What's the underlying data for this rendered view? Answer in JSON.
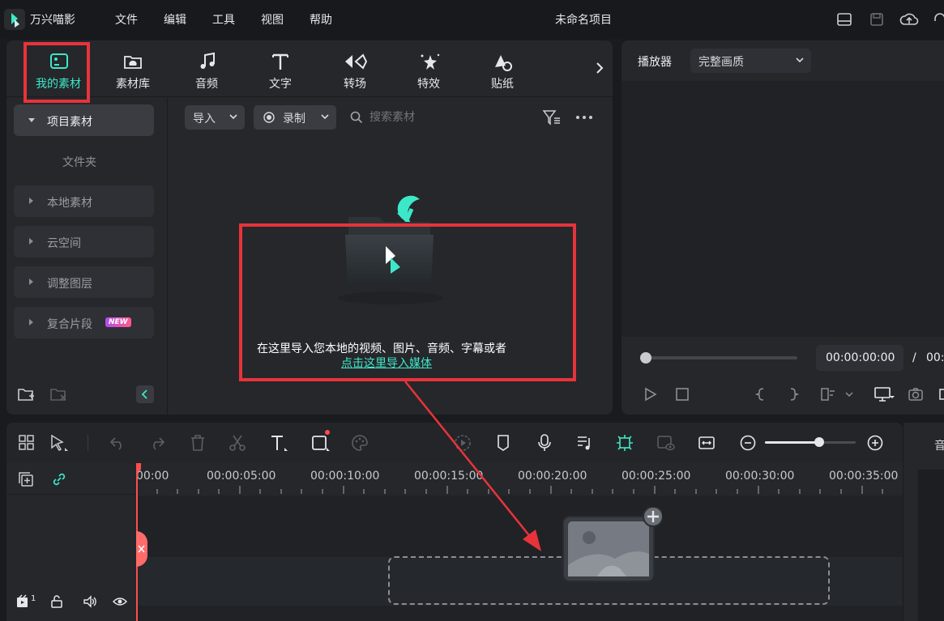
{
  "app": {
    "name": "万兴喵影",
    "project_title": "未命名项目"
  },
  "menu": [
    "文件",
    "编辑",
    "工具",
    "视图",
    "帮助"
  ],
  "tabs": [
    {
      "label": "我的素材",
      "icon": "my-media-icon",
      "active": true
    },
    {
      "label": "素材库",
      "icon": "stock-library-icon"
    },
    {
      "label": "音频",
      "icon": "music-note-icon"
    },
    {
      "label": "文字",
      "icon": "text-icon"
    },
    {
      "label": "转场",
      "icon": "transition-icon"
    },
    {
      "label": "特效",
      "icon": "effects-icon"
    },
    {
      "label": "贴纸",
      "icon": "sticker-icon"
    }
  ],
  "sidebar": {
    "project_media": "项目素材",
    "folder": "文件夹",
    "items": [
      "本地素材",
      "云空间",
      "调整图层",
      "复合片段"
    ],
    "new_badge": "NEW"
  },
  "media_toolbar": {
    "import": "导入",
    "record": "录制",
    "search_placeholder": "搜索素材"
  },
  "media_empty": {
    "hint": "在这里导入您本地的视频、图片、音频、字幕或者",
    "link": "点击这里导入媒体"
  },
  "player": {
    "label": "播放器",
    "quality": "完整画质",
    "timecode": "00:00:00:00",
    "separator": "/",
    "total": "00:"
  },
  "timeline": {
    "ruler": [
      "00:00",
      "00:00:05:00",
      "00:00:10:00",
      "00:00:15:00",
      "00:00:20:00",
      "00:00:25:00",
      "00:00:30:00",
      "00:00:35:00"
    ],
    "track_count": "1",
    "right_panel_label": "音"
  },
  "colors": {
    "accent": "#3de8c8",
    "highlight": "#e8333a",
    "link": "#3de8c8"
  }
}
